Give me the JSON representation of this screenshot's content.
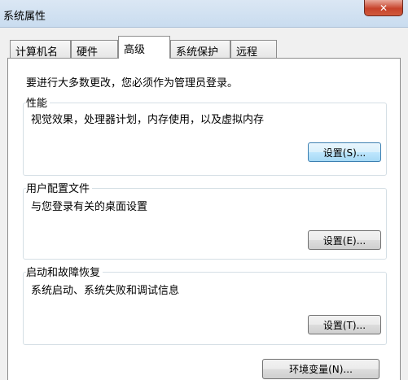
{
  "window": {
    "title": "系统属性",
    "close_glyph": "✕"
  },
  "tabs": [
    {
      "label": "计算机名"
    },
    {
      "label": "硬件"
    },
    {
      "label": "高级",
      "active": true
    },
    {
      "label": "系统保护"
    },
    {
      "label": "远程"
    }
  ],
  "advanced": {
    "admin_note": "要进行大多数更改，您必须作为管理员登录。",
    "performance": {
      "title": "性能",
      "description": "视觉效果，处理器计划，内存使用，以及虚拟内存",
      "button": "设置(S)..."
    },
    "user_profiles": {
      "title": "用户配置文件",
      "description": "与您登录有关的桌面设置",
      "button": "设置(E)..."
    },
    "startup_recovery": {
      "title": "启动和故障恢复",
      "description": "系统启动、系统失败和调试信息",
      "button": "设置(T)..."
    },
    "env_button": "环境变量(N)..."
  },
  "colors": {
    "titlebar": "#c9dcef",
    "close_button": "#c7432b",
    "focused_button": "#bee6fd"
  }
}
